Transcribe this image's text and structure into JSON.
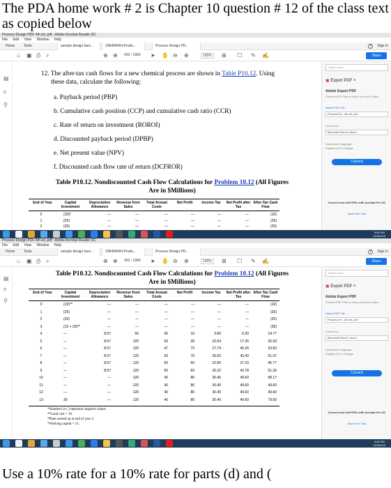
{
  "caption_top": "The PDA home work # 2 is Chapter 10 question # 12 of the class text as copied below",
  "caption_bottom": "Use a 10% rate for a 10% rate for parts (d) and (",
  "window": {
    "title": "Process Design PDF 4th ed..pdf - Adobe Acrobat Reader DC",
    "menu": [
      "File",
      "Edit",
      "View",
      "Window",
      "Help"
    ],
    "tabs": [
      "Home",
      "Tools",
      "sample design basi...",
      "208468464-Produ...",
      "Process Design PD..."
    ],
    "sign_in": "Sign In",
    "share": "Share",
    "page_indicator_1": "455 / 1886",
    "page_indicator_2": "455 / 1886",
    "zoom": "100%"
  },
  "right_pane": {
    "search": "Search tools",
    "export_pdf": "Export PDF",
    "export_title": "Adobe Export PDF",
    "export_desc": "Convert PDF Files to Word or Excel Online",
    "select_file": "Select PDF File",
    "file_name": "Process De...4th ed..pdf",
    "convert_to": "Convert to",
    "format": "Microsoft Word (*.docx)",
    "doc_lang": "Document Language:",
    "lang": "English (U.S.) Change",
    "convert_btn": "Convert",
    "promo": "Convert and edit PDFs with Acrobat Pro DC",
    "trial": "Start Free Trial"
  },
  "taskbar": {
    "time1": "3:45 PM",
    "date1": "11/5/2019",
    "time2": "3:45 PM",
    "date2": "11/5/2019"
  },
  "question": {
    "intro": "12. The after-tax cash flows for a new chemical process are shown in",
    "table_link": "Table P10.12",
    "intro_end": ". Using",
    "line2": "these data, calculate the following:",
    "items": [
      "a. Payback period (PBP)",
      "b. Cumulative cash position (CCP) and cumulative cash ratio (CCR)",
      "c. Rate of return on investment (ROROI)",
      "d. Discounted payback period (DPBP)",
      "e. Net present value (NPV)",
      "f. Discounted cash flow rate of return (DCFROR)"
    ]
  },
  "table": {
    "title_pre": "Table P10.12. Nondiscounted Cash Flow Calculations for",
    "title_link": "Problem 10.12",
    "title_post": "(All Figures",
    "title_line2": "Are in $Millions)",
    "headers": [
      "End of Year",
      "Capital Investment",
      "Depreciation Allowance",
      "Revenue from Sales",
      "Total Annual Costs",
      "Net Profit",
      "Income Tax",
      "Net Profit after Tax",
      "After-Tax Cash Flow"
    ],
    "rows_partial": [
      [
        "0",
        "(10)*",
        "—",
        "—",
        "—",
        "—",
        "—",
        "—",
        "(10)"
      ],
      [
        "1",
        "(25)",
        "—",
        "—",
        "—",
        "—",
        "—",
        "—",
        "(25)"
      ],
      [
        "2",
        "(20)",
        "—",
        "—",
        "—",
        "—",
        "—",
        "—",
        "(20)"
      ]
    ],
    "rows": [
      [
        "0",
        "(10)**",
        "—",
        "—",
        "—",
        "—",
        "—",
        "—",
        "(10)"
      ],
      [
        "1",
        "(25)",
        "—",
        "—",
        "—",
        "—",
        "—",
        "—",
        "(25)"
      ],
      [
        "2",
        "(20)",
        "—",
        "—",
        "—",
        "—",
        "—",
        "—",
        "(20)"
      ],
      [
        "3",
        "(15 + 20)**",
        "—",
        "—",
        "—",
        "—",
        "—",
        "—",
        "(35)"
      ],
      [
        "4",
        "—",
        "8.57",
        "60",
        "30",
        "10",
        "3.80",
        "6.20",
        "14.77"
      ],
      [
        "5",
        "—",
        "8.57",
        "120",
        "50",
        "28",
        "10.64",
        "17.36",
        "25.93"
      ],
      [
        "6",
        "—",
        "8.57",
        "120",
        "47",
        "73",
        "27.74",
        "45.26",
        "53.83"
      ],
      [
        "7",
        "—",
        "8.57",
        "120",
        "50",
        "70",
        "26.60",
        "43.40",
        "51.97"
      ],
      [
        "8",
        "—",
        "8.57",
        "120",
        "60",
        "60",
        "22.80",
        "37.20",
        "45.77"
      ],
      [
        "9",
        "—",
        "8.57",
        "120",
        "60",
        "69",
        "26.22",
        "42.78",
        "51.35"
      ],
      [
        "10",
        "—",
        "—",
        "120",
        "40",
        "80",
        "30.40",
        "49.60",
        "58.17"
      ],
      [
        "11",
        "—",
        "—",
        "120",
        "40",
        "80",
        "30.40",
        "49.60",
        "49.60"
      ],
      [
        "12",
        "—",
        "—",
        "120",
        "40",
        "80",
        "30.40",
        "49.60",
        "49.60"
      ],
      [
        "13",
        "30",
        "—",
        "120",
        "40",
        "80",
        "30.40",
        "49.60",
        "79.60"
      ]
    ],
    "notes": [
      "*Numbers in ( ) represent negative values.",
      "**Land cost = 10.",
      "*Plant started up at end of year 3.",
      "*Working capital = 15."
    ]
  }
}
